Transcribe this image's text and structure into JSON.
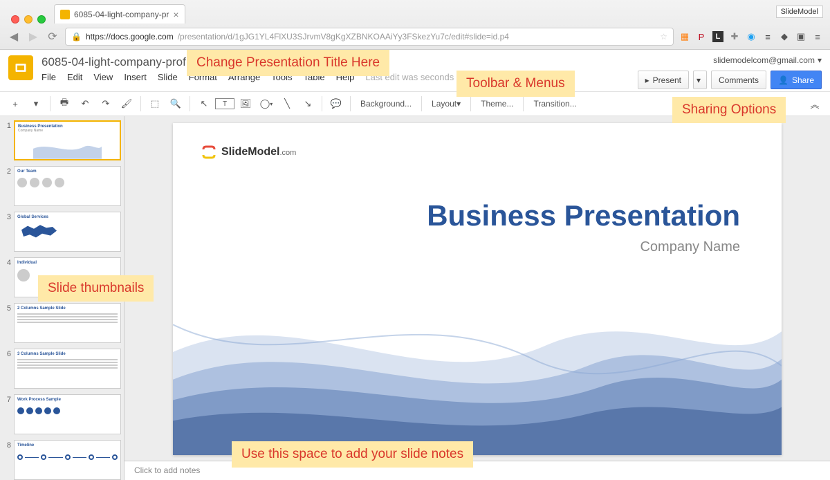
{
  "browser": {
    "tab_title": "6085-04-light-company-pr",
    "extension_label": "SlideModel",
    "url_domain": "https://docs.google.com",
    "url_path": "/presentation/d/1gJG1YL4FlXU3SJrvmV8gKgXZBNKOAAiYy3FSkezYu7c/edit#slide=id.p4"
  },
  "ext_icons": [
    "★",
    "▦",
    "P",
    "L",
    "✚",
    "◉",
    "≡",
    "◆",
    "▣",
    "≡"
  ],
  "header": {
    "doc_title": "6085-04-light-company-profile.pptx",
    "menus": [
      "File",
      "Edit",
      "View",
      "Insert",
      "Slide",
      "Format",
      "Arrange",
      "Tools",
      "Table",
      "Help"
    ],
    "last_edit": "Last edit was seconds ago",
    "user_email": "slidemodelcom@gmail.com",
    "present": "Present",
    "comments": "Comments",
    "share": "Share"
  },
  "toolbar": {
    "background": "Background...",
    "layout": "Layout",
    "theme": "Theme...",
    "transition": "Transition..."
  },
  "thumbs": [
    {
      "n": "1",
      "title": "Business Presentation",
      "sub": "Company Name",
      "selected": true,
      "type": "title"
    },
    {
      "n": "2",
      "title": "Our Team",
      "type": "team"
    },
    {
      "n": "3",
      "title": "Global Services",
      "type": "map"
    },
    {
      "n": "4",
      "title": "Individual",
      "type": "person"
    },
    {
      "n": "5",
      "title": "2 Columns Sample Slide",
      "type": "text"
    },
    {
      "n": "6",
      "title": "3 Columns Sample Slide",
      "type": "text"
    },
    {
      "n": "7",
      "title": "Work Process Sample",
      "type": "icons"
    },
    {
      "n": "8",
      "title": "Timeline",
      "type": "timeline"
    }
  ],
  "slide": {
    "logo_text": "SlideModel",
    "logo_suffix": ".com",
    "title": "Business Presentation",
    "subtitle": "Company Name"
  },
  "notes_placeholder": "Click to add notes",
  "annotations": {
    "title": "Change Presentation Title Here",
    "toolbar": "Toolbar & Menus",
    "sharing": "Sharing Options",
    "thumbs": "Slide thumbnails",
    "notes": "Use this space to add your slide notes"
  }
}
